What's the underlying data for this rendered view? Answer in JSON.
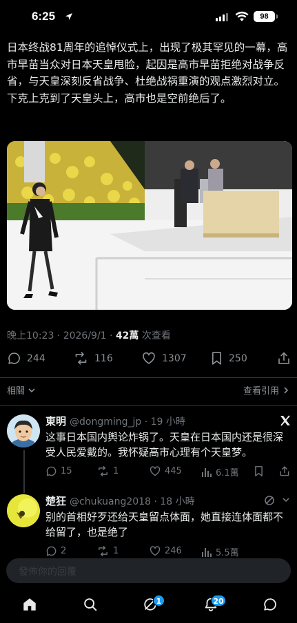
{
  "status_bar": {
    "time": "6:25",
    "battery": "98"
  },
  "post": {
    "text": "日本终战81周年的追悼仪式上，出现了极其罕见的一幕，高市早苗当众对日本天皇甩脸，起因是高市早苗拒绝对战争反省，与天皇深刻反省战争、杜绝战祸重演的观点激烈对立。\n下克上克到了天皇头上，高市也是空前绝后了。",
    "timestamp": "晚上10:23 · 2026/9/1 · ",
    "views": "42萬",
    "views_suffix": " 次查看",
    "stats": {
      "replies": "244",
      "reposts": "116",
      "likes": "1307",
      "bookmarks": "250"
    }
  },
  "related_label": "相關",
  "quotes_label": "查看引用",
  "replies": [
    {
      "name": "東明",
      "handle": "@dongming_jp · 19 小時",
      "text": "这事日本国内舆论炸锅了。天皇在日本国内还是很深受人民爱戴的。我怀疑高市心理有个天皇梦。",
      "stats": {
        "replies": "15",
        "reposts": "1",
        "likes": "445",
        "views": "6.1萬"
      }
    },
    {
      "name": "楚狂",
      "handle": "@chukuang2018 · 18 小時",
      "text": "别的首相好歹还给天皇留点体面，她直接连体面都不给留了，也是绝了",
      "stats": {
        "replies": "2",
        "reposts": "1",
        "likes": "246",
        "views": "5.5萬"
      }
    }
  ],
  "composer": {
    "placeholder": "發佈你的回覆"
  },
  "tabbar": {
    "grok_badge": "1",
    "notifications_badge": "20"
  },
  "colors": {
    "accent": "#1d9bf0",
    "background": "#000000",
    "muted": "#71767b"
  }
}
